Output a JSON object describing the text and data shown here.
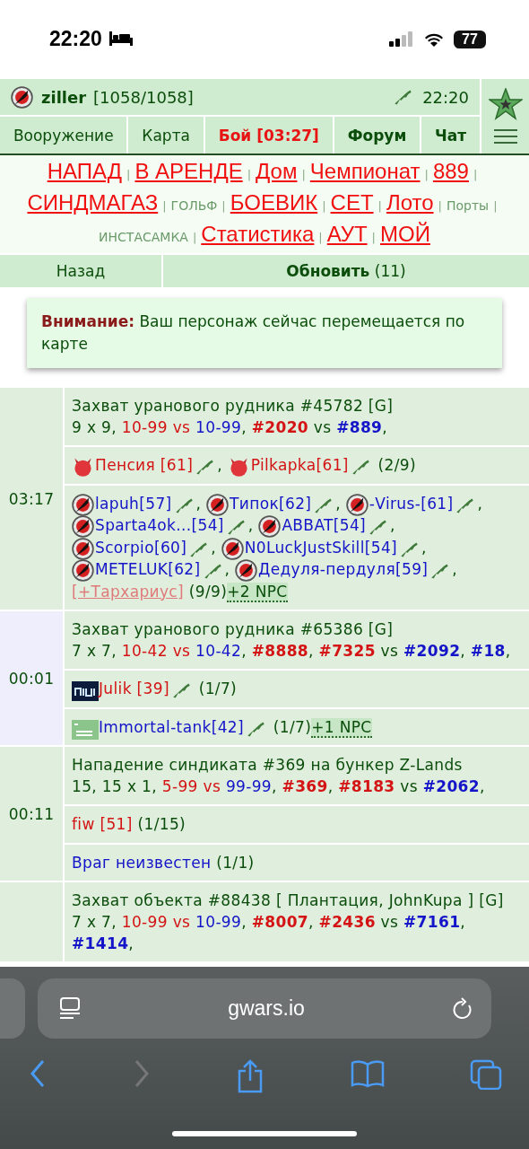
{
  "status_bar": {
    "time": "22:20",
    "battery": "77"
  },
  "header": {
    "user": "ziller",
    "hp": "[1058/1058]",
    "time": "22:20"
  },
  "nav_tabs": [
    {
      "label": "Вооружение",
      "kind": "plain"
    },
    {
      "label": "Карта",
      "kind": "plain"
    },
    {
      "label": "Бой [03:27]",
      "kind": "alert"
    },
    {
      "label": "Форум",
      "kind": "bold"
    },
    {
      "label": "Чат",
      "kind": "bold"
    }
  ],
  "links": [
    {
      "label": "НАПАД",
      "kind": "big"
    },
    {
      "label": "|",
      "kind": "sep"
    },
    {
      "label": "В АРЕНДЕ",
      "kind": "big"
    },
    {
      "label": "|",
      "kind": "sep"
    },
    {
      "label": "Дом",
      "kind": "big"
    },
    {
      "label": "|",
      "kind": "sep"
    },
    {
      "label": "Чемпионат",
      "kind": "big"
    },
    {
      "label": "|",
      "kind": "sep"
    },
    {
      "label": "889",
      "kind": "big"
    },
    {
      "label": "|",
      "kind": "sep"
    },
    {
      "label": "СИНДМАГАЗ",
      "kind": "big"
    },
    {
      "label": "|",
      "kind": "sep"
    },
    {
      "label": "ГОЛЬФ",
      "kind": "small"
    },
    {
      "label": "|",
      "kind": "sep"
    },
    {
      "label": "БОЕВИК",
      "kind": "big"
    },
    {
      "label": "|",
      "kind": "sep"
    },
    {
      "label": "СЕТ",
      "kind": "big"
    },
    {
      "label": "|",
      "kind": "sep"
    },
    {
      "label": "Лото",
      "kind": "big"
    },
    {
      "label": "|",
      "kind": "sep"
    },
    {
      "label": "Порты",
      "kind": "small"
    },
    {
      "label": "|",
      "kind": "sep"
    },
    {
      "label": "ИНСТАСАМКА",
      "kind": "small"
    },
    {
      "label": "|",
      "kind": "sep"
    },
    {
      "label": "Статистика",
      "kind": "big"
    },
    {
      "label": "|",
      "kind": "sep"
    },
    {
      "label": "АУТ",
      "kind": "big"
    },
    {
      "label": "|",
      "kind": "sep"
    },
    {
      "label": "МОЙ",
      "kind": "big"
    }
  ],
  "actions": {
    "back": "Назад",
    "refresh": "Обновить",
    "refresh_count": "(11)"
  },
  "notice": {
    "label": "Внимание:",
    "text": "Ваш персонаж сейчас перемещается по карте"
  },
  "battles": [
    {
      "time": "03:17",
      "highlighted": false,
      "title": "Захват уранового рудника #45782 [G]",
      "info": [
        {
          "text": "9 x 9, ",
          "kind": "plain"
        },
        {
          "text": "10-99 vs",
          "kind": "red"
        },
        {
          "text": " 10-99",
          "kind": "blue"
        },
        {
          "text": ", ",
          "kind": "plain"
        },
        {
          "text": "#2020",
          "kind": "red-bold"
        },
        {
          "text": " vs ",
          "kind": "plain"
        },
        {
          "text": "#889",
          "kind": "blue-bold"
        },
        {
          "text": ",",
          "kind": "plain"
        }
      ],
      "groups": [
        {
          "items": [
            {
              "kind": "devil",
              "name": "Пенсия [61]",
              "color": "#d41414",
              "armed": true,
              "after": ","
            },
            {
              "kind": "devil",
              "name": "Pilkapka[61]",
              "color": "#d41414",
              "armed": true
            }
          ],
          "count": "(2/9)"
        },
        {
          "items": [
            {
              "kind": "rocket",
              "name": "lapuh[57]",
              "color": "#1414c8",
              "armed": true,
              "after": ","
            },
            {
              "kind": "rocket",
              "name": "Типок[62]",
              "color": "#1414c8",
              "armed": true,
              "after": ","
            },
            {
              "kind": "rocket",
              "name": "-Virus-[61]",
              "color": "#1414c8",
              "armed": true,
              "after": ","
            },
            {
              "kind": "rocket",
              "name": "Sparta4ok...[54]",
              "color": "#1414c8",
              "armed": true,
              "after": ","
            },
            {
              "kind": "rocket",
              "name": "ABBAT[54]",
              "color": "#1414c8",
              "armed": true,
              "after": ","
            },
            {
              "kind": "rocket",
              "name": "Scorpio[60]",
              "color": "#1414c8",
              "armed": true,
              "after": ","
            },
            {
              "kind": "rocket",
              "name": "N0LuckJustSkill[54]",
              "color": "#1414c8",
              "armed": true,
              "after": ","
            },
            {
              "kind": "rocket",
              "name": "METELUK[62]",
              "color": "#1414c8",
              "armed": true,
              "after": ","
            },
            {
              "kind": "rocket",
              "name": "Дедуля-пердуля[59]",
              "color": "#1414c8",
              "armed": true,
              "after": ","
            },
            {
              "kind": "reserve",
              "name": "[+Тархариус]",
              "color": "#e07a7a",
              "armed": false
            }
          ],
          "count": "(9/9)",
          "npc": "+2 NPC"
        }
      ]
    },
    {
      "time": "00:01",
      "highlighted": true,
      "title": "Захват уранового рудника #65386 [G]",
      "info": [
        {
          "text": "7 x 7, ",
          "kind": "plain"
        },
        {
          "text": "10-42 vs",
          "kind": "red"
        },
        {
          "text": " 10-42",
          "kind": "blue"
        },
        {
          "text": ", ",
          "kind": "plain"
        },
        {
          "text": "#8888",
          "kind": "red-bold"
        },
        {
          "text": ", ",
          "kind": "plain"
        },
        {
          "text": "#7325",
          "kind": "red-bold"
        },
        {
          "text": " vs ",
          "kind": "plain"
        },
        {
          "text": "#2092",
          "kind": "blue-bold"
        },
        {
          "text": ", ",
          "kind": "plain"
        },
        {
          "text": "#18",
          "kind": "blue-bold"
        },
        {
          "text": ",",
          "kind": "plain"
        }
      ],
      "groups": [
        {
          "items": [
            {
              "kind": "clan",
              "name": "Julik [39]",
              "color": "#d41414",
              "armed": true
            }
          ],
          "count": "(1/7)"
        },
        {
          "items": [
            {
              "kind": "tank",
              "name": "Immortal-tank[42]",
              "color": "#1414c8",
              "armed": true
            }
          ],
          "count": "(1/7)",
          "npc": "+1 NPC"
        }
      ]
    },
    {
      "time": "00:11",
      "highlighted": false,
      "title": "Нападение синдиката #369 на бункер Z-Lands",
      "info": [
        {
          "text": "15, 15 x 1, ",
          "kind": "plain"
        },
        {
          "text": "5-99 vs",
          "kind": "red"
        },
        {
          "text": " 99-99",
          "kind": "blue"
        },
        {
          "text": ", ",
          "kind": "plain"
        },
        {
          "text": "#369",
          "kind": "red-bold"
        },
        {
          "text": ", ",
          "kind": "plain"
        },
        {
          "text": "#8183",
          "kind": "red-bold"
        },
        {
          "text": " vs ",
          "kind": "plain"
        },
        {
          "text": "#2062",
          "kind": "blue-bold"
        },
        {
          "text": ",",
          "kind": "plain"
        }
      ],
      "groups": [
        {
          "items": [
            {
              "kind": "plain",
              "name": "fiw [51]",
              "color": "#d41414",
              "armed": false
            }
          ],
          "count": "(1/15)"
        },
        {
          "items": [
            {
              "kind": "plain",
              "name": "Враг неизвестен",
              "color": "#1414c8",
              "armed": false
            }
          ],
          "count": "(1/1)"
        }
      ]
    },
    {
      "highlighted": false,
      "title": "Захват объекта #88438 [ Плантация, JohnKupa ] [G]",
      "info": [
        {
          "text": "7 x 7, ",
          "kind": "plain"
        },
        {
          "text": "10-99 vs",
          "kind": "red"
        },
        {
          "text": " 10-99",
          "kind": "blue"
        },
        {
          "text": ", ",
          "kind": "plain"
        },
        {
          "text": "#8007",
          "kind": "red-bold"
        },
        {
          "text": ", ",
          "kind": "plain"
        },
        {
          "text": "#2436",
          "kind": "red-bold"
        },
        {
          "text": " vs ",
          "kind": "plain"
        },
        {
          "text": "#7161",
          "kind": "blue-bold"
        },
        {
          "text": ", ",
          "kind": "plain"
        },
        {
          "text": "#1414",
          "kind": "blue-bold"
        },
        {
          "text": ",",
          "kind": "plain"
        }
      ]
    }
  ],
  "browser": {
    "url": "gwars.io"
  }
}
